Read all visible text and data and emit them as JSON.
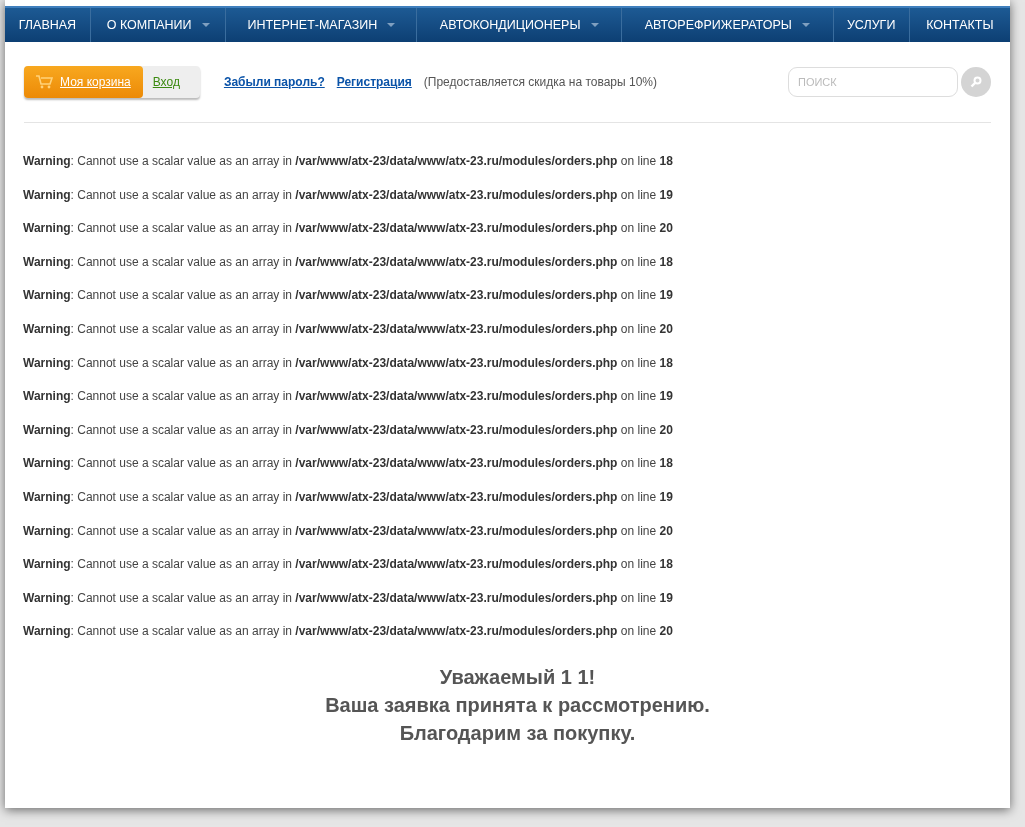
{
  "nav": [
    {
      "label": "ГЛАВНАЯ",
      "dropdown": false
    },
    {
      "label": "О КОМПАНИИ",
      "dropdown": true
    },
    {
      "label": "ИНТЕРНЕТ-МАГАЗИН",
      "dropdown": true
    },
    {
      "label": "АВТОКОНДИЦИОНЕРЫ",
      "dropdown": true
    },
    {
      "label": "АВТОРЕФРИЖЕРАТОРЫ",
      "dropdown": true
    },
    {
      "label": "УСЛУГИ",
      "dropdown": false
    },
    {
      "label": "КОНТАКТЫ",
      "dropdown": false
    }
  ],
  "cart": {
    "label": "Моя корзина",
    "login": "Вход"
  },
  "links": [
    "Забыли пароль?",
    "Регистрация"
  ],
  "note": "(Предоставляется скидка на товары 10%)",
  "search": {
    "placeholder": "ПОИСК"
  },
  "warnings": [
    "**Warning**: Cannot use a scalar value as an array in **/var/www/atx-23/data/www/atx-23.ru/modules/orders.php** on line **18**",
    "**Warning**: Cannot use a scalar value as an array in **/var/www/atx-23/data/www/atx-23.ru/modules/orders.php** on line **19**",
    "**Warning**: Cannot use a scalar value as an array in **/var/www/atx-23/data/www/atx-23.ru/modules/orders.php** on line **20**",
    "**Warning**: Cannot use a scalar value as an array in **/var/www/atx-23/data/www/atx-23.ru/modules/orders.php** on line **18**",
    "**Warning**: Cannot use a scalar value as an array in **/var/www/atx-23/data/www/atx-23.ru/modules/orders.php** on line **19**",
    "**Warning**: Cannot use a scalar value as an array in **/var/www/atx-23/data/www/atx-23.ru/modules/orders.php** on line **20**",
    "**Warning**: Cannot use a scalar value as an array in **/var/www/atx-23/data/www/atx-23.ru/modules/orders.php** on line **18**",
    "**Warning**: Cannot use a scalar value as an array in **/var/www/atx-23/data/www/atx-23.ru/modules/orders.php** on line **19**",
    "**Warning**: Cannot use a scalar value as an array in **/var/www/atx-23/data/www/atx-23.ru/modules/orders.php** on line **20**",
    "**Warning**: Cannot use a scalar value as an array in **/var/www/atx-23/data/www/atx-23.ru/modules/orders.php** on line **18**",
    "**Warning**: Cannot use a scalar value as an array in **/var/www/atx-23/data/www/atx-23.ru/modules/orders.php** on line **19**",
    "**Warning**: Cannot use a scalar value as an array in **/var/www/atx-23/data/www/atx-23.ru/modules/orders.php** on line **20**",
    "**Warning**: Cannot use a scalar value as an array in **/var/www/atx-23/data/www/atx-23.ru/modules/orders.php** on line **18**",
    "**Warning**: Cannot use a scalar value as an array in **/var/www/atx-23/data/www/atx-23.ru/modules/orders.php** on line **19**",
    "**Warning**: Cannot use a scalar value as an array in **/var/www/atx-23/data/www/atx-23.ru/modules/orders.php** on line **20**"
  ],
  "message": [
    "Уважаемый 1 1!",
    "Ваша заявка принята к рассмотрению.",
    "Благодарим за покупку."
  ]
}
